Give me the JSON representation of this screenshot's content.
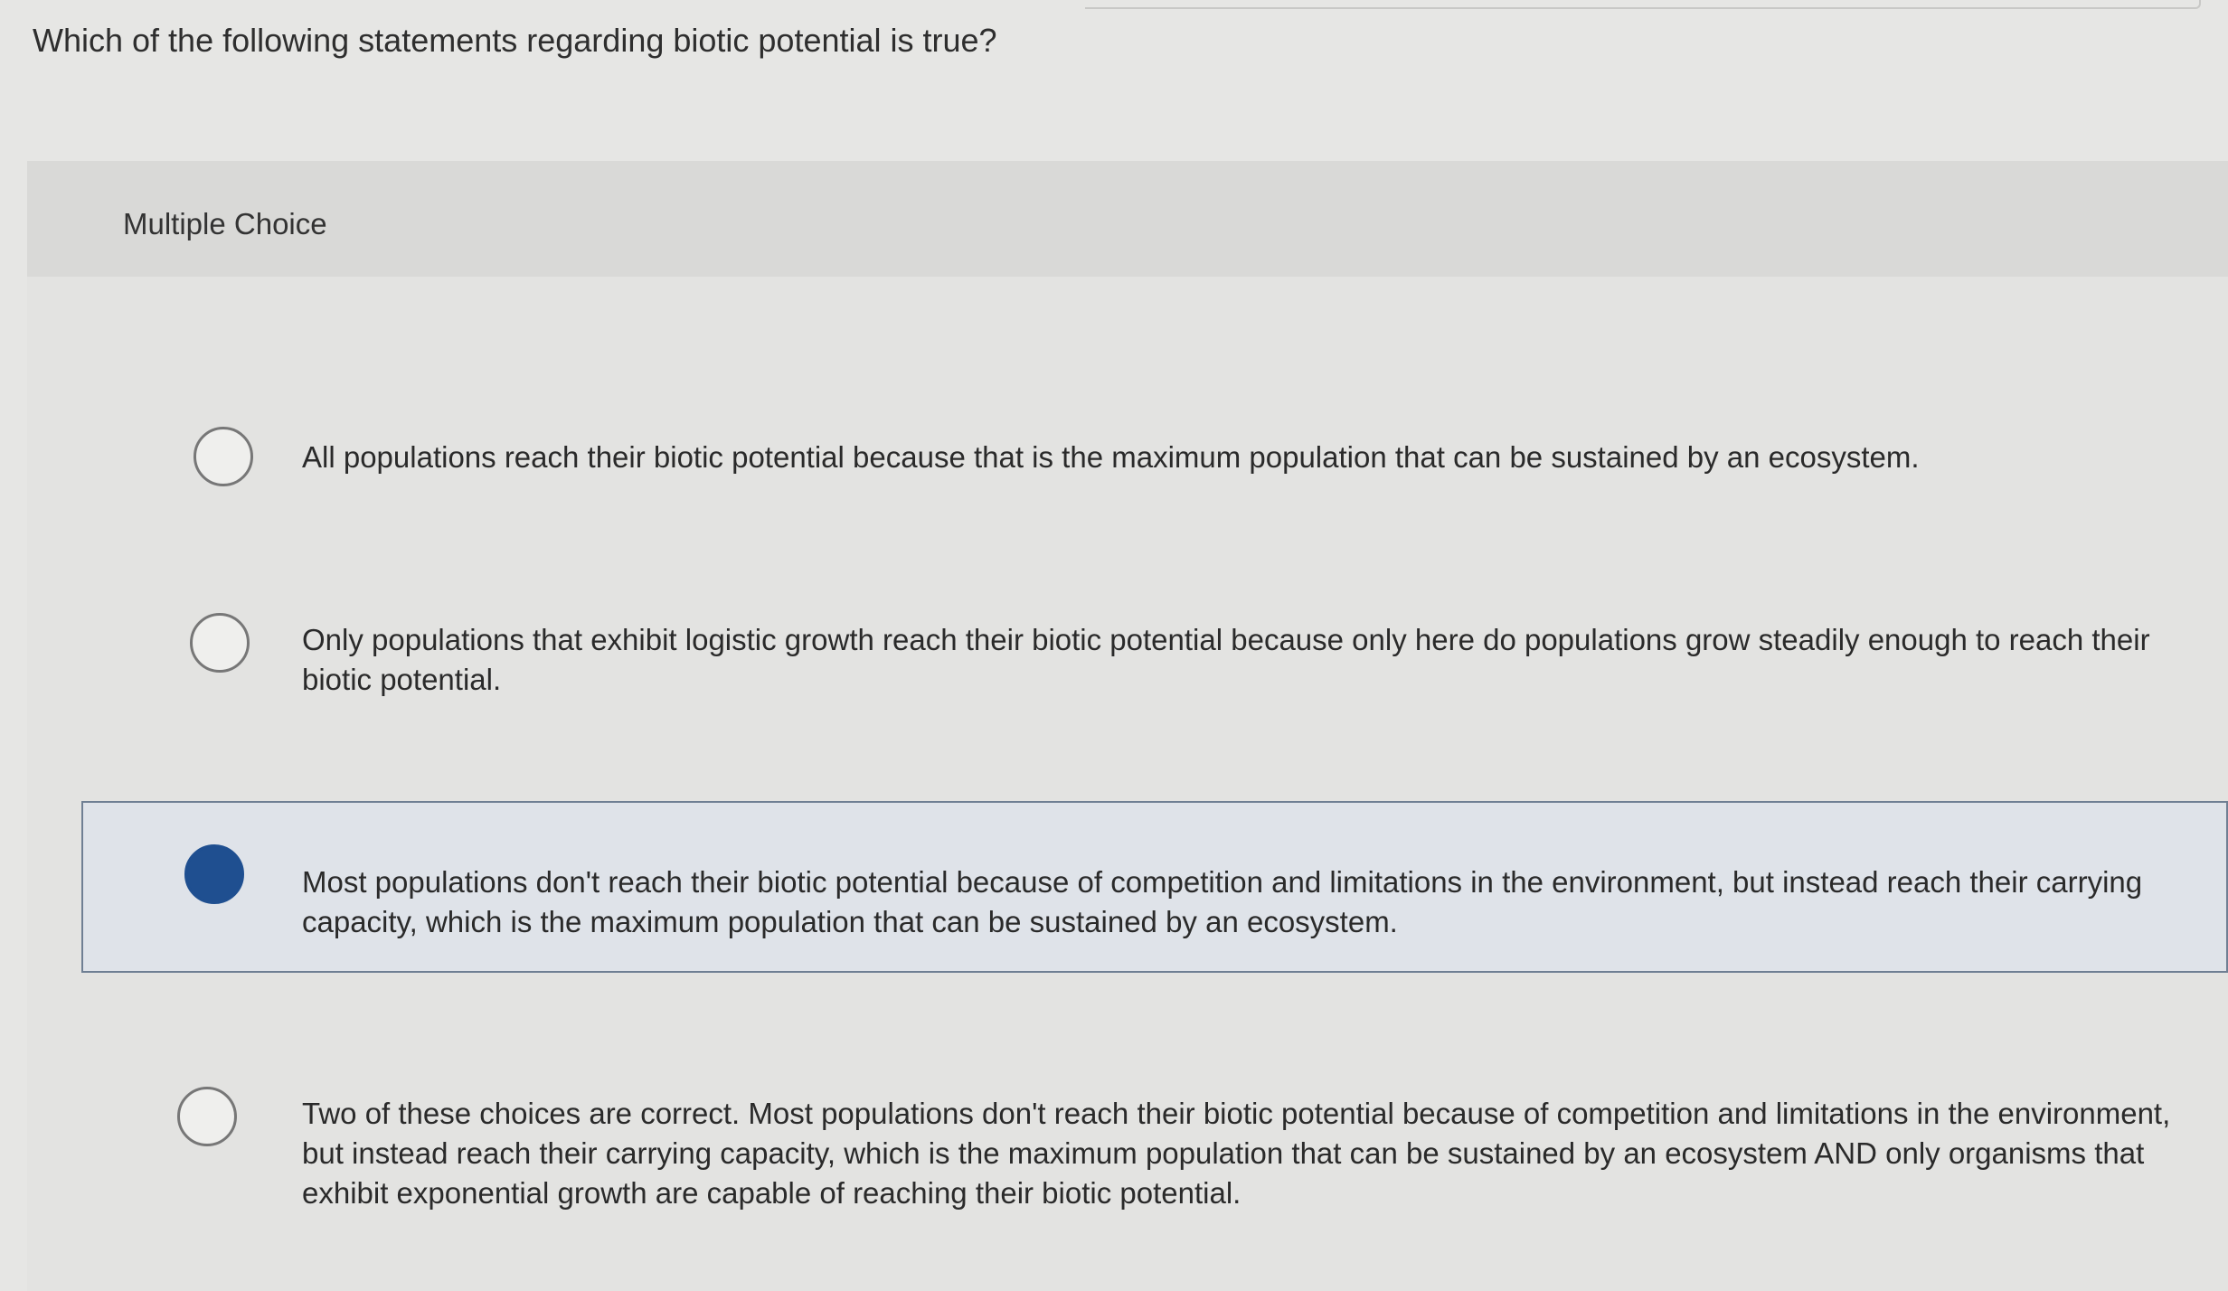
{
  "question": {
    "text": "Which of the following statements regarding biotic potential is true?"
  },
  "card": {
    "type_label": "Multiple Choice"
  },
  "options": [
    {
      "text": "All populations reach their biotic potential because that is the maximum population that can be sustained by an ecosystem.",
      "selected": false
    },
    {
      "text": "Only populations that exhibit logistic growth reach their biotic potential because only here do populations grow steadily enough to reach their biotic potential.",
      "selected": false
    },
    {
      "text": "Most populations don't reach their biotic potential because of competition and limitations in the environment, but instead reach their carrying capacity, which is the maximum population that can be sustained by an ecosystem.",
      "selected": true
    },
    {
      "text": "Two of these choices are correct. Most populations don't reach their biotic potential because of competition and limitations in the environment, but instead reach their carrying capacity, which is the maximum population that can be sustained by an ecosystem AND only organisms that exhibit exponential growth are capable of reaching their biotic potential.",
      "selected": false
    }
  ],
  "colors": {
    "selected_radio": "#1f4f90",
    "selected_background": "#dfe3e9"
  }
}
